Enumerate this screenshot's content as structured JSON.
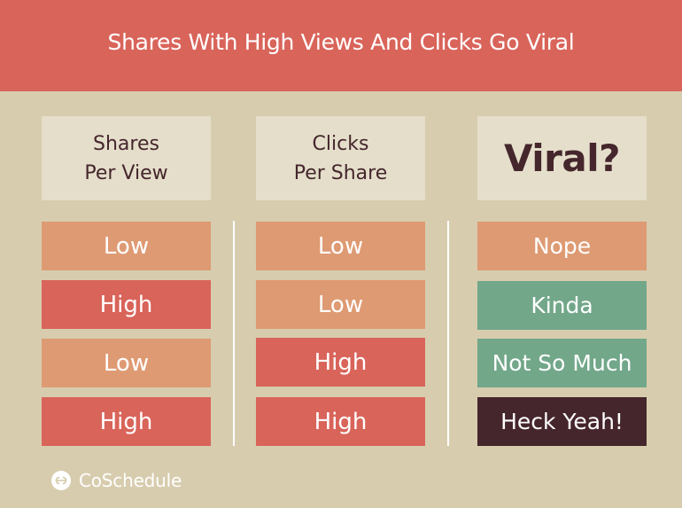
{
  "header": {
    "title": "Shares With High Views And Clicks Go Viral"
  },
  "colors": {
    "banner": "#D9645A",
    "background": "#D7CCAE",
    "header_box": "#E4DECA",
    "header_text": "#45262C",
    "low": "#DE9A73",
    "high": "#D9645A",
    "green": "#72A78A",
    "dark": "#45262C"
  },
  "columns": [
    {
      "heading": "Shares\nPer View",
      "cells": [
        {
          "label": "Low",
          "tone": "low"
        },
        {
          "label": "High",
          "tone": "high"
        },
        {
          "label": "Low",
          "tone": "low"
        },
        {
          "label": "High",
          "tone": "high"
        }
      ]
    },
    {
      "heading": "Clicks\nPer Share",
      "cells": [
        {
          "label": "Low",
          "tone": "low"
        },
        {
          "label": "Low",
          "tone": "low"
        },
        {
          "label": "High",
          "tone": "high"
        },
        {
          "label": "High",
          "tone": "high"
        }
      ]
    },
    {
      "heading": "Viral?",
      "cells": [
        {
          "label": "Nope",
          "tone": "low"
        },
        {
          "label": "Kinda",
          "tone": "green"
        },
        {
          "label": "Not So Much",
          "tone": "green"
        },
        {
          "label": "Heck Yeah!",
          "tone": "dark"
        }
      ]
    }
  ],
  "brand": {
    "name": "CoSchedule",
    "icon": "coschedule-logo-icon"
  }
}
